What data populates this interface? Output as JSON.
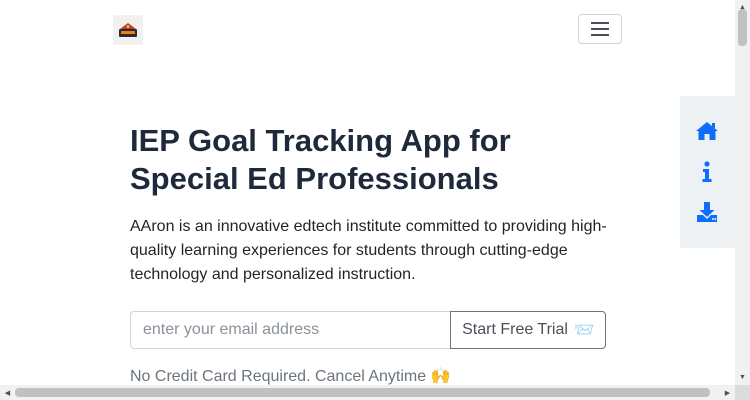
{
  "navbar": {
    "logo_alt": "AAron logo",
    "menu_icon": "hamburger-menu-icon"
  },
  "hero": {
    "title": "IEP Goal Tracking App for Special Ed Professionals",
    "description": "AAron is an innovative edtech institute committed to providing high-quality learning experiences for students through cutting-edge technology and personalized instruction.",
    "email_placeholder": "enter your email address",
    "cta_label": "Start Free Trial",
    "cta_emoji": "📨",
    "note": "No Credit Card Required. Cancel Anytime 🙌"
  },
  "side_panel": {
    "icons": [
      "home-icon",
      "info-icon",
      "download-icon"
    ]
  },
  "colors": {
    "accent": "#0d6efd",
    "title": "#1e293b",
    "muted": "#6c757d",
    "panel_bg": "#eef1f4"
  }
}
